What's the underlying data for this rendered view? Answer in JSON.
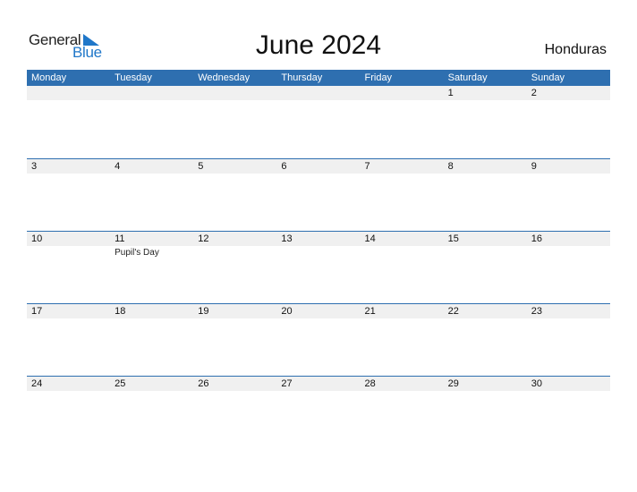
{
  "logo": {
    "general": "General",
    "blue": "Blue"
  },
  "title": "June 2024",
  "country": "Honduras",
  "weekdays": [
    "Monday",
    "Tuesday",
    "Wednesday",
    "Thursday",
    "Friday",
    "Saturday",
    "Sunday"
  ],
  "weeks": [
    {
      "days": [
        "",
        "",
        "",
        "",
        "",
        "1",
        "2"
      ],
      "events": [
        "",
        "",
        "",
        "",
        "",
        "",
        ""
      ]
    },
    {
      "days": [
        "3",
        "4",
        "5",
        "6",
        "7",
        "8",
        "9"
      ],
      "events": [
        "",
        "",
        "",
        "",
        "",
        "",
        ""
      ]
    },
    {
      "days": [
        "10",
        "11",
        "12",
        "13",
        "14",
        "15",
        "16"
      ],
      "events": [
        "",
        "Pupil's Day",
        "",
        "",
        "",
        "",
        ""
      ]
    },
    {
      "days": [
        "17",
        "18",
        "19",
        "20",
        "21",
        "22",
        "23"
      ],
      "events": [
        "",
        "",
        "",
        "",
        "",
        "",
        ""
      ]
    },
    {
      "days": [
        "24",
        "25",
        "26",
        "27",
        "28",
        "29",
        "30"
      ],
      "events": [
        "",
        "",
        "",
        "",
        "",
        "",
        ""
      ]
    }
  ],
  "colors": {
    "header": "#2e6fb0",
    "brand": "#1f77c9",
    "row_bg": "#f0f0f0"
  }
}
